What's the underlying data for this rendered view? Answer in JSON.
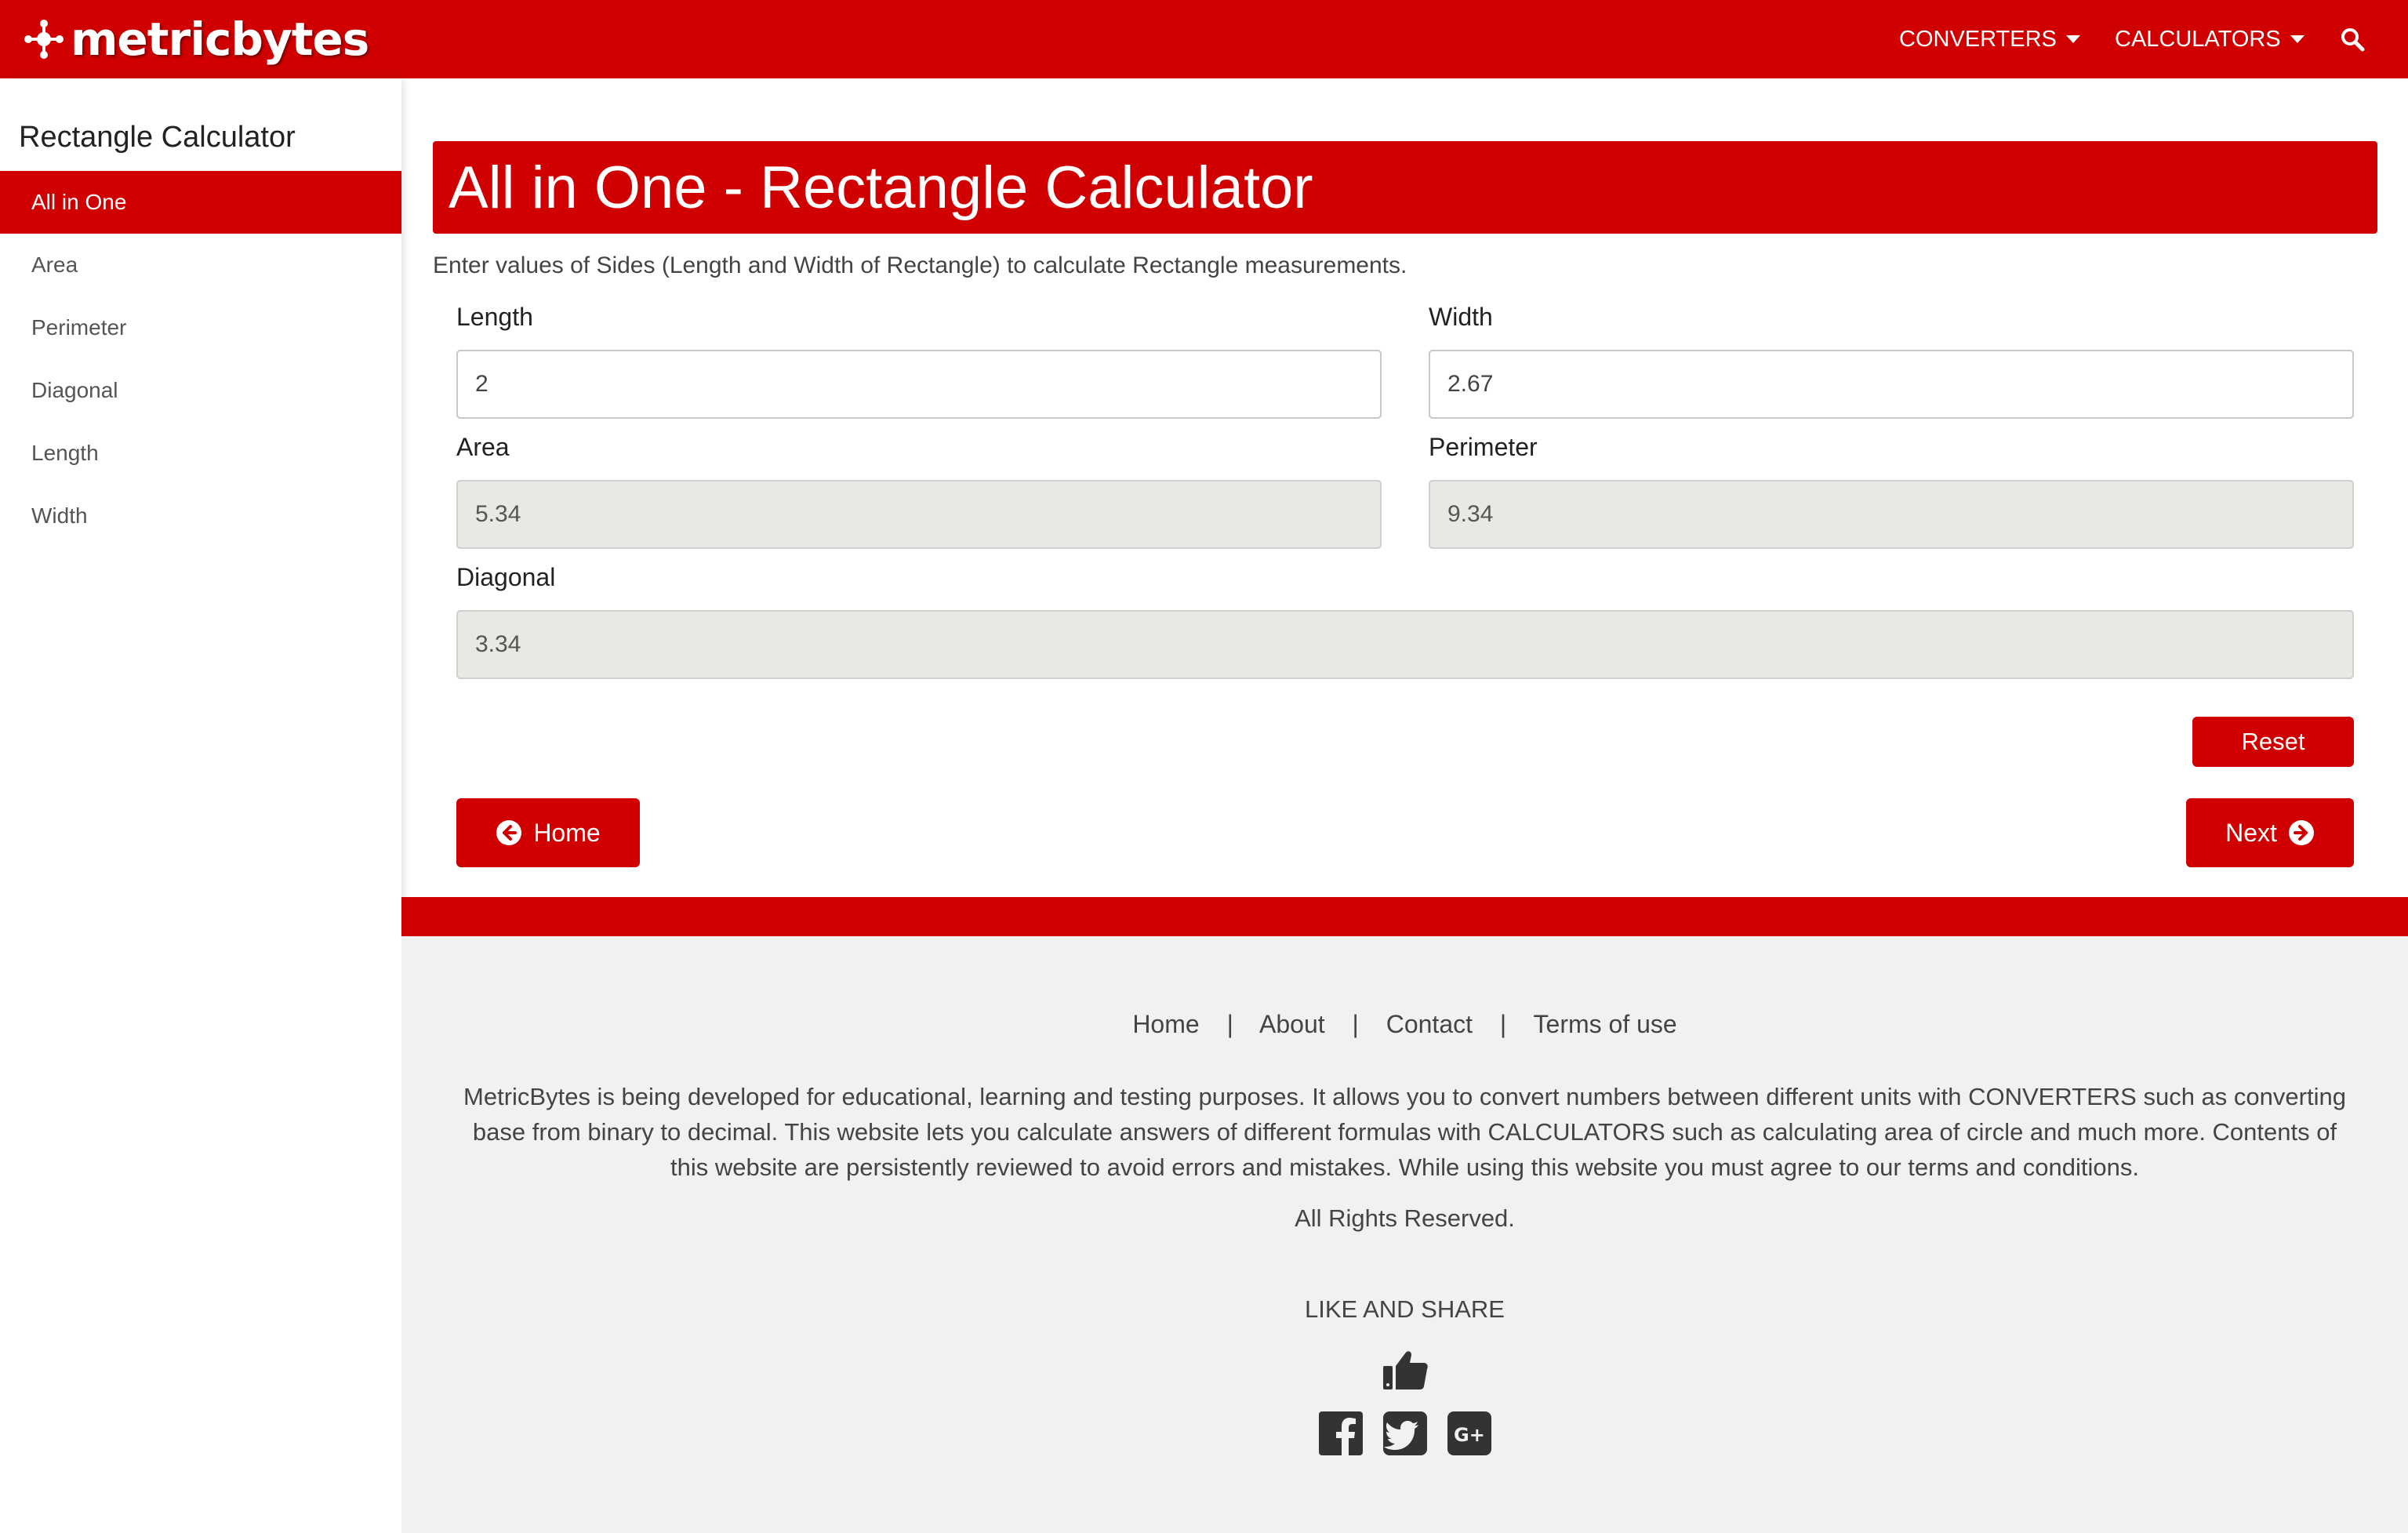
{
  "brand": {
    "name": "metricbytes",
    "accent": "#d00000"
  },
  "nav": {
    "converters": "CONVERTERS",
    "calculators": "CALCULATORS",
    "search_icon": "search-icon"
  },
  "sidebar": {
    "title": "Rectangle Calculator",
    "items": [
      {
        "label": "All in One",
        "active": true
      },
      {
        "label": "Area"
      },
      {
        "label": "Perimeter"
      },
      {
        "label": "Diagonal"
      },
      {
        "label": "Length"
      },
      {
        "label": "Width"
      }
    ]
  },
  "main": {
    "title": "All in One - Rectangle Calculator",
    "intro": "Enter values of Sides (Length and Width of Rectangle) to calculate Rectangle measurements.",
    "fields": {
      "length": {
        "label": "Length",
        "value": "2"
      },
      "width": {
        "label": "Width",
        "value": "2.67"
      },
      "area": {
        "label": "Area",
        "value": "5.34"
      },
      "perimeter": {
        "label": "Perimeter",
        "value": "9.34"
      },
      "diagonal": {
        "label": "Diagonal",
        "value": "3.34"
      }
    },
    "reset_label": "Reset",
    "home_label": "Home",
    "next_label": "Next"
  },
  "footer": {
    "links": [
      "Home",
      "About",
      "Contact",
      "Terms of use"
    ],
    "separator": "|",
    "description": "MetricBytes is being developed for educational, learning and testing purposes. It allows you to convert numbers between different units with CONVERTERS such as converting base from binary to decimal. This website lets you calculate answers of different formulas with CALCULATORS such as calculating area of circle and much more. Contents of this website are persistently reviewed to avoid errors and mistakes. While using this website you must agree to our terms and conditions.",
    "rights": "All Rights Reserved.",
    "share_heading": "LIKE AND SHARE",
    "social_icons": [
      "facebook-icon",
      "twitter-icon",
      "google-plus-icon"
    ]
  }
}
